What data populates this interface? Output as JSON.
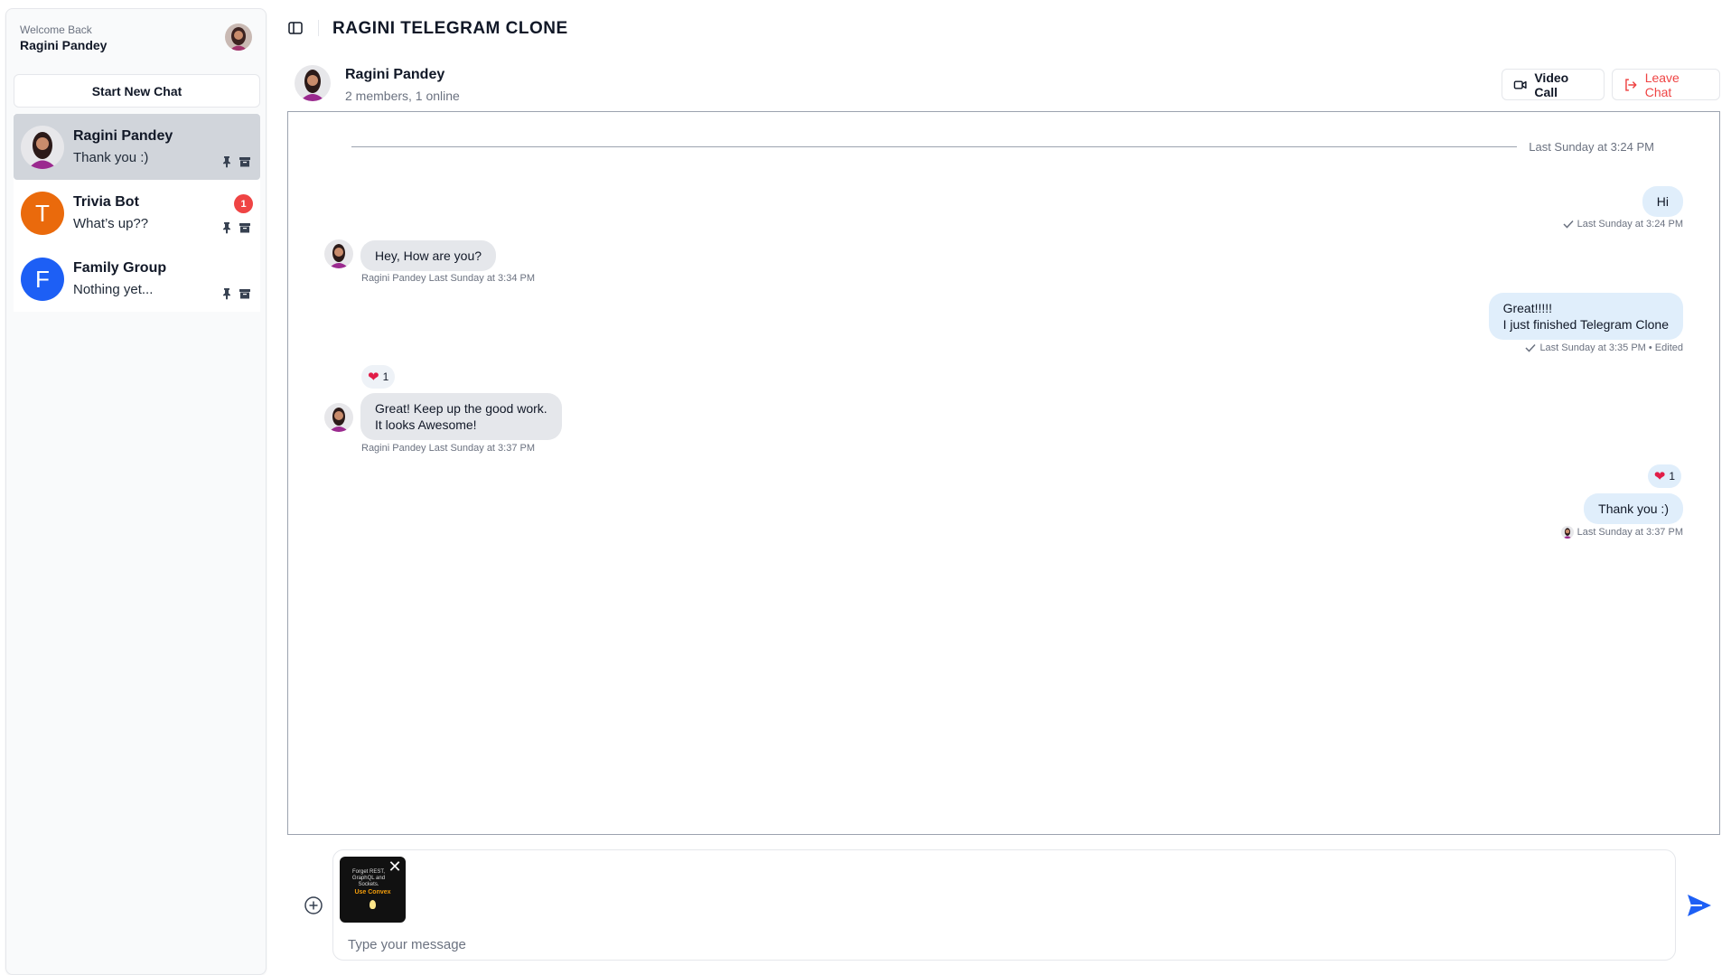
{
  "sidebar": {
    "welcome_small": "Welcome Back",
    "user_name": "Ragini Pandey",
    "new_chat_label": "Start New Chat",
    "chats": [
      {
        "name": "Ragini Pandey",
        "last": "Thank you :)",
        "active": true,
        "avatar": "photo"
      },
      {
        "name": "Trivia Bot",
        "last": "What’s up??",
        "badge": "1",
        "avatar_letter": "T",
        "avatar_color": "#ea6a0c"
      },
      {
        "name": "Family Group",
        "last": "Nothing yet...",
        "avatar_letter": "F",
        "avatar_color": "#1d5ff5"
      }
    ]
  },
  "topbar": {
    "title": "RAGINI TELEGRAM CLONE"
  },
  "chat_header": {
    "name": "Ragini Pandey",
    "status": "2 members, 1 online",
    "video_call_label": "Video Call",
    "leave_chat_label": "Leave Chat"
  },
  "messages": {
    "date_divider": "Last Sunday at 3:24 PM",
    "items": [
      {
        "text": "Hi",
        "meta": "Last Sunday at 3:24 PM"
      },
      {
        "text": "Hey, How are you?",
        "meta": "Ragini Pandey Last Sunday at 3:34 PM"
      },
      {
        "line1": "Great!!!!!",
        "line2": "I just finished Telegram Clone",
        "meta": "Last Sunday at 3:35 PM • Edited"
      },
      {
        "reaction": "1",
        "line1": "Great! Keep up the good work.",
        "line2": "It looks Awesome!",
        "meta": "Ragini Pandey Last Sunday at 3:37 PM"
      },
      {
        "reaction": "1",
        "text": "Thank you :)",
        "meta": "Last Sunday at 3:37 PM"
      }
    ]
  },
  "composer": {
    "placeholder": "Type your message",
    "attachment": {
      "line1": "Forget REST, GraphQL and Sockets.",
      "cta": "Use Convex"
    }
  },
  "colors": {
    "accent": "#1d5ff5",
    "danger": "#ef4444",
    "outgoing_bubble": "#e0eefb",
    "incoming_bubble": "#e5e7eb"
  }
}
